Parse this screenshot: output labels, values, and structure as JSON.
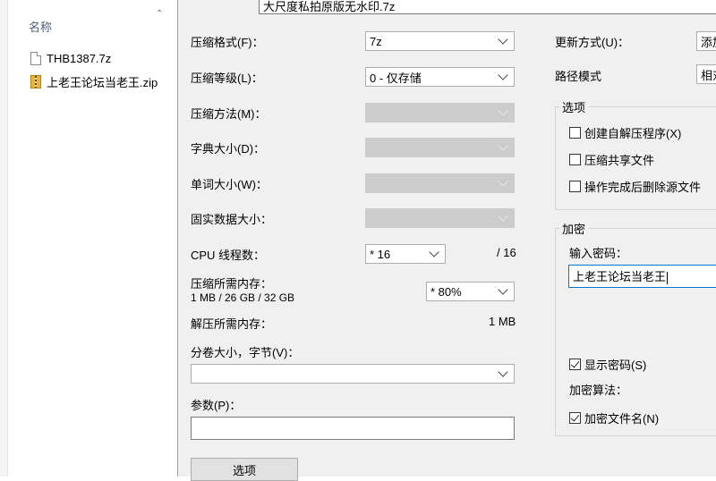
{
  "explorer": {
    "column_header": "名称",
    "files": [
      {
        "name": "THB1387.7z",
        "type": "file"
      },
      {
        "name": "上老王论坛当老王.zip",
        "type": "zip"
      }
    ]
  },
  "dialog": {
    "archive_name": "大尺度私拍原版无水印.7z",
    "left": {
      "format_label": "压缩格式(F)：",
      "format_value": "7z",
      "level_label": "压缩等级(L)：",
      "level_value": "0 - 仅存储",
      "method_label": "压缩方法(M)：",
      "dict_label": "字典大小(D)：",
      "word_label": "单词大小(W)：",
      "solid_label": "固实数据大小：",
      "cpu_label": "CPU 线程数：",
      "cpu_value": "* 16",
      "cpu_total": "/ 16",
      "mem_comp_label": "压缩所需内存：",
      "mem_comp_value": "1 MB / 26 GB / 32 GB",
      "mem_comp_percent": "* 80%",
      "mem_decomp_label": "解压所需内存：",
      "mem_decomp_value": "1 MB",
      "split_label": "分卷大小，字节(V)：",
      "split_value": "",
      "params_label": "参数(P)：",
      "params_value": "",
      "options_button": "选项"
    },
    "right": {
      "update_label": "更新方式(U)：",
      "update_value": "添加",
      "path_label": "路径模式",
      "path_value": "相对",
      "options_group": "选项",
      "opt_sfx": "创建自解压程序(X)",
      "opt_shared": "压缩共享文件",
      "opt_delete": "操作完成后删除源文件",
      "encrypt_group": "加密",
      "password_label": "输入密码：",
      "password_value": "上老王论坛当老王",
      "show_password": "显示密码(S)",
      "method_label": "加密算法：",
      "encrypt_names": "加密文件名(N)"
    }
  }
}
